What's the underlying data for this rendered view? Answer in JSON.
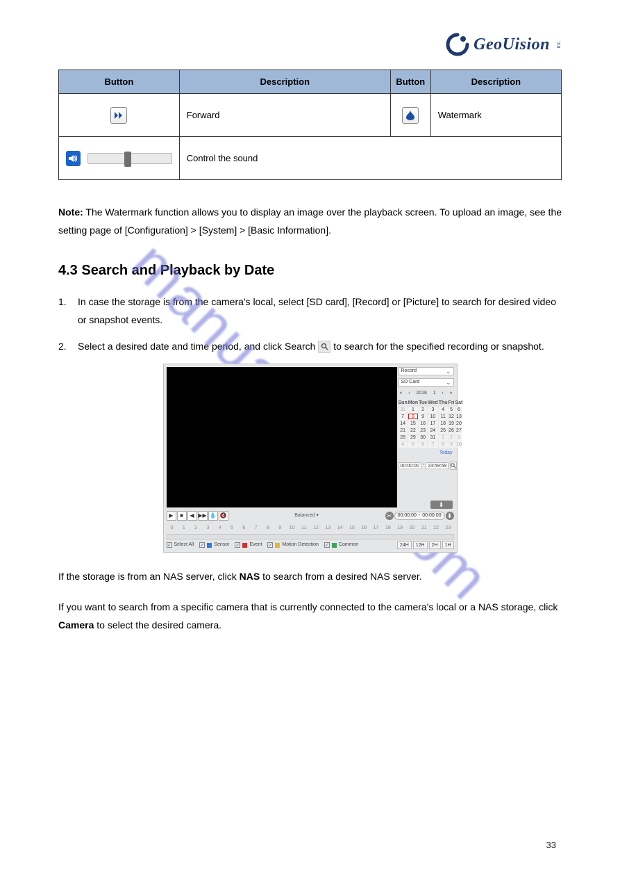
{
  "brand": {
    "name": "GeoUision",
    "inc": "Inc."
  },
  "watermark": "manualshive.com",
  "table": {
    "headers": [
      "Button",
      "Description",
      "Button",
      "Description"
    ],
    "row1": {
      "icon1_name": "forward-icon",
      "desc1": "Forward",
      "icon2_name": "watermark-icon",
      "desc2": "Watermark"
    },
    "row2": {
      "vol_icon_name": "volume-icon",
      "slider_name": "volume-slider",
      "desc": "Control the sound"
    }
  },
  "note_label": "Note:",
  "note_text": " The Watermark function allows you to display an image over the playback screen. To upload an image, see the setting page of [Configuration] > [System] > [Basic Information].",
  "section_title": "4.3 Search and Playback by Date",
  "steps": {
    "s1": "In case the storage is from the camera's local, select [SD card], [Record] or [Picture] to search for desired video or snapshot events.",
    "s2_a": "Select a desired date and time period, and click Search ",
    "s2_b": " to search for the specified recording or snapshot."
  },
  "screenshot": {
    "dropdowns": {
      "record": "Record",
      "storage": "SD Card"
    },
    "cal": {
      "nav_prev2": "«",
      "nav_prev": "‹",
      "year": "2018",
      "month": "1",
      "nav_next": "›",
      "nav_next2": "»",
      "dow": [
        "Sun",
        "Mon",
        "Tue",
        "Wed",
        "Thu",
        "Fri",
        "Sat"
      ],
      "rows": [
        [
          "31",
          "1",
          "2",
          "3",
          "4",
          "5",
          "6"
        ],
        [
          "7",
          "8",
          "9",
          "10",
          "11",
          "12",
          "13"
        ],
        [
          "14",
          "15",
          "16",
          "17",
          "18",
          "19",
          "20"
        ],
        [
          "21",
          "22",
          "23",
          "24",
          "25",
          "26",
          "27"
        ],
        [
          "28",
          "29",
          "30",
          "31",
          "1",
          "2",
          "3"
        ],
        [
          "4",
          "5",
          "6",
          "7",
          "8",
          "9",
          "10"
        ]
      ],
      "today": "Today"
    },
    "time": {
      "from": "00:00:00",
      "sep": "-",
      "to": "23:59:59"
    },
    "controls": {
      "balanced": "Balanced",
      "range_from": "00:00:00",
      "range_to": "00:00:00"
    },
    "timeline_ticks": [
      "0",
      "1",
      "2",
      "3",
      "4",
      "5",
      "6",
      "7",
      "8",
      "9",
      "10",
      "11",
      "12",
      "13",
      "14",
      "15",
      "16",
      "17",
      "18",
      "19",
      "20",
      "21",
      "22",
      "23"
    ],
    "filters": {
      "all": "Select All",
      "sensor": "Sensor",
      "event": "Event",
      "motion": "Motion Detection",
      "common": "Common"
    },
    "zoom": [
      "24H",
      "12H",
      "2H",
      "1H"
    ]
  },
  "followups": {
    "p1_a": "If the storage is from an NAS server, click ",
    "p1_b": "NAS",
    "p1_c": " to search from a desired NAS server.",
    "p2_a": "If you want to search from a specific camera that is currently connected to the camera's local or a NAS storage, click ",
    "p2_b": "Camera",
    "p2_c": " to select the desired camera."
  },
  "page_number": "33"
}
